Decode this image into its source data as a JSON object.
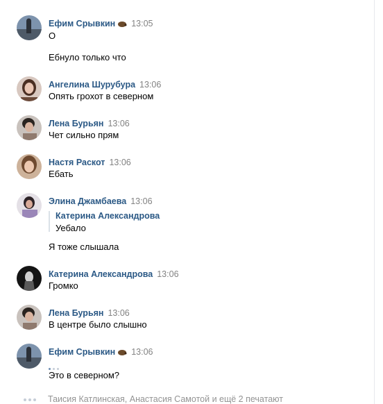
{
  "messages": [
    {
      "author": "Ефим Срывкин",
      "emoji_icon": "hedgehog-icon",
      "time": "13:05",
      "lines": [
        "О",
        "Ебнуло только что"
      ]
    },
    {
      "author": "Ангелина Шурубура",
      "time": "13:06",
      "lines": [
        "Опять грохот в северном"
      ]
    },
    {
      "author": "Лена Бурьян",
      "time": "13:06",
      "lines": [
        "Чет сильно прям"
      ]
    },
    {
      "author": "Настя Раскот",
      "time": "13:06",
      "lines": [
        "Ебать"
      ]
    },
    {
      "author": "Элина Джамбаева",
      "time": "13:06",
      "quote": {
        "author": "Катерина Александрова",
        "text": "Уебало"
      },
      "lines": [
        "Я тоже слышала"
      ]
    },
    {
      "author": "Катерина Александрова",
      "time": "13:06",
      "lines": [
        "Громко"
      ]
    },
    {
      "author": "Лена Бурьян",
      "time": "13:06",
      "lines": [
        "В центре было слышно"
      ]
    },
    {
      "author": "Ефим Срывкин",
      "emoji_icon": "hedgehog-icon",
      "time": "13:06",
      "status_icon": "sending-dots-icon",
      "lines": [
        "Это в северном?"
      ]
    }
  ],
  "typing_indicator": {
    "icon": "typing-dots-icon",
    "text": "Таисия Катлинская, Анастасия Самотой и ещё 2 печатают"
  },
  "colors": {
    "author_link": "#2a5885",
    "time": "#828282",
    "quote_border": "#dae1e8",
    "typing_text": "#939393"
  }
}
